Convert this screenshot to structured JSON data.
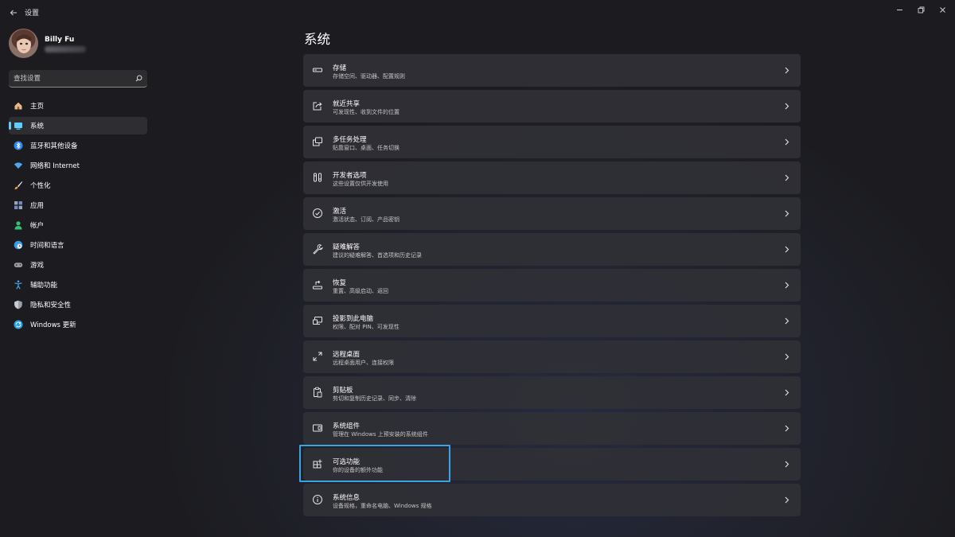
{
  "window": {
    "title": "设置",
    "back_icon": "back-arrow-icon",
    "controls": [
      "minimize-icon",
      "restore-icon",
      "close-icon"
    ]
  },
  "user": {
    "name": "Billy Fu"
  },
  "search": {
    "placeholder": "查找设置",
    "icon": "search-icon"
  },
  "nav": {
    "items": [
      {
        "label": "主页",
        "icon": "home-icon",
        "color": "#e8b98a"
      },
      {
        "label": "系统",
        "icon": "system-monitor-icon",
        "color": "#60cdff",
        "active": true
      },
      {
        "label": "蓝牙和其他设备",
        "icon": "bluetooth-icon",
        "color": "#2f88f0"
      },
      {
        "label": "网络和 Internet",
        "icon": "wifi-icon",
        "color": "#4ca6f0"
      },
      {
        "label": "个性化",
        "icon": "brush-icon",
        "color": "#f0a040"
      },
      {
        "label": "应用",
        "icon": "apps-icon",
        "color": "#9aa6b8"
      },
      {
        "label": "帐户",
        "icon": "account-icon",
        "color": "#35c07a"
      },
      {
        "label": "时间和语言",
        "icon": "globe-clock-icon",
        "color": "#3a9de8"
      },
      {
        "label": "游戏",
        "icon": "gamepad-icon",
        "color": "#9a9aa2"
      },
      {
        "label": "辅助功能",
        "icon": "accessibility-icon",
        "color": "#4aa8f0"
      },
      {
        "label": "隐私和安全性",
        "icon": "shield-icon",
        "color": "#9aa0aa"
      },
      {
        "label": "Windows 更新",
        "icon": "update-icon",
        "color": "#2f9fe8"
      }
    ]
  },
  "main": {
    "title": "系统",
    "cards": [
      {
        "title": "存储",
        "subtitle": "存储空间、驱动器、配置规则",
        "icon": "storage-icon"
      },
      {
        "title": "就近共享",
        "subtitle": "可发现性、收到文件的位置",
        "icon": "share-icon"
      },
      {
        "title": "多任务处理",
        "subtitle": "贴靠窗口、桌面、任务切换",
        "icon": "multitask-icon"
      },
      {
        "title": "开发者选项",
        "subtitle": "这些设置仅供开发使用",
        "icon": "developer-tools-icon"
      },
      {
        "title": "激活",
        "subtitle": "激活状态、订阅、产品密钥",
        "icon": "activation-check-icon"
      },
      {
        "title": "疑难解答",
        "subtitle": "建议的疑难解答、首选项和历史记录",
        "icon": "wrench-icon"
      },
      {
        "title": "恢复",
        "subtitle": "重置、高级启动、返回",
        "icon": "recovery-icon"
      },
      {
        "title": "投影到此电脑",
        "subtitle": "权限、配对 PIN、可发现性",
        "icon": "project-to-pc-icon"
      },
      {
        "title": "远程桌面",
        "subtitle": "远程桌面用户、连接权限",
        "icon": "remote-desktop-icon"
      },
      {
        "title": "剪贴板",
        "subtitle": "剪切和复制历史记录、同步、清除",
        "icon": "clipboard-icon"
      },
      {
        "title": "系统组件",
        "subtitle": "管理在 Windows 上预安装的系统组件",
        "icon": "system-components-icon"
      },
      {
        "title": "可选功能",
        "subtitle": "你的设备的额外功能",
        "icon": "optional-features-icon",
        "highlighted": true
      },
      {
        "title": "系统信息",
        "subtitle": "设备规格，重命名电脑、Windows 规格",
        "icon": "info-icon"
      }
    ]
  },
  "colors": {
    "accent": "#60cdff",
    "highlight_border": "#3aa3e3",
    "card_bg": "#303036",
    "window_bg": "#1c1c20"
  }
}
